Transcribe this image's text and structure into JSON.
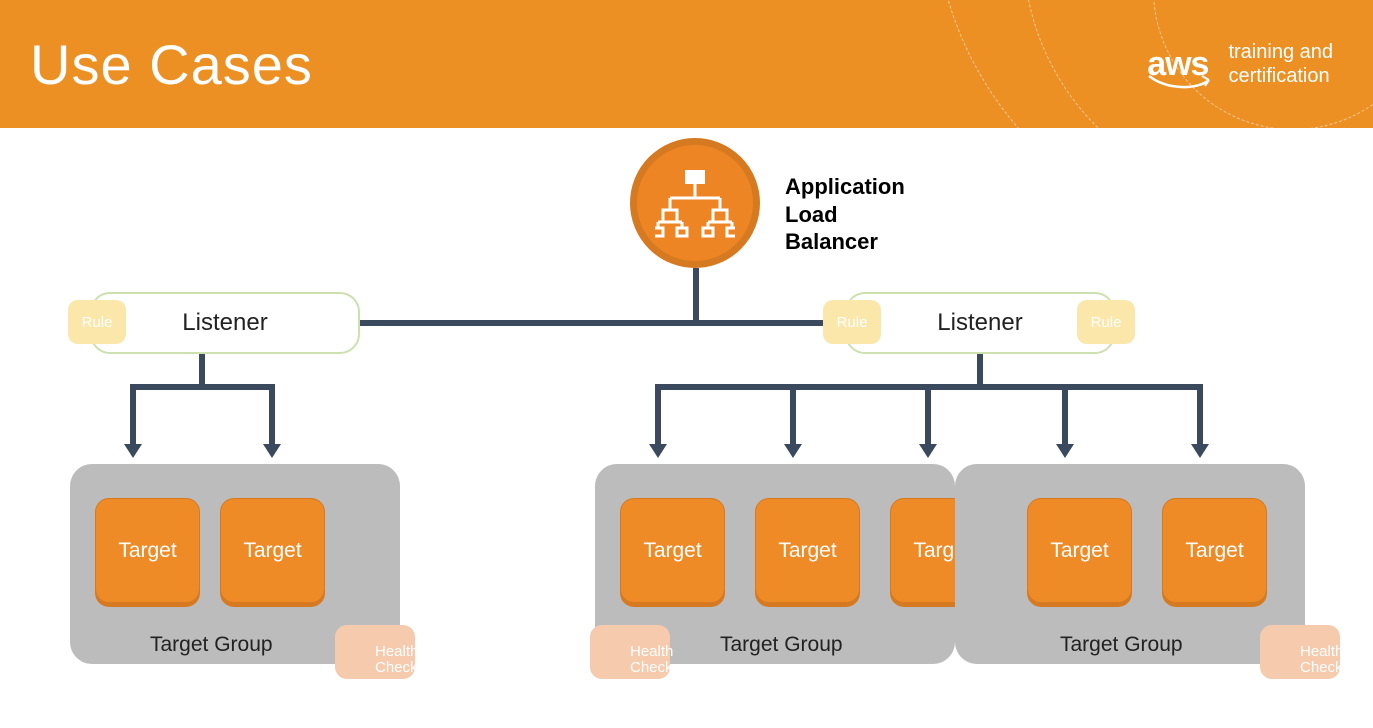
{
  "header": {
    "title": "Use Cases",
    "logo_text": "aws",
    "subtext_line1": "training and",
    "subtext_line2": "certification"
  },
  "alb": {
    "label_line1": "Application",
    "label_line2": "Load Balancer"
  },
  "listeners": [
    {
      "label": "Listener"
    },
    {
      "label": "Listener"
    }
  ],
  "rule_label": "Rule",
  "target_label": "Target",
  "target_group_label": "Target Group",
  "health_check": {
    "line1": "Health",
    "line2": "Check"
  },
  "colors": {
    "brand_orange": "#ec9024",
    "dark_orange": "#ee8524",
    "line": "#3a495e",
    "gray": "#bcbcbc",
    "rule_badge": "#fbe7aa",
    "hc_badge": "#f6caac"
  }
}
